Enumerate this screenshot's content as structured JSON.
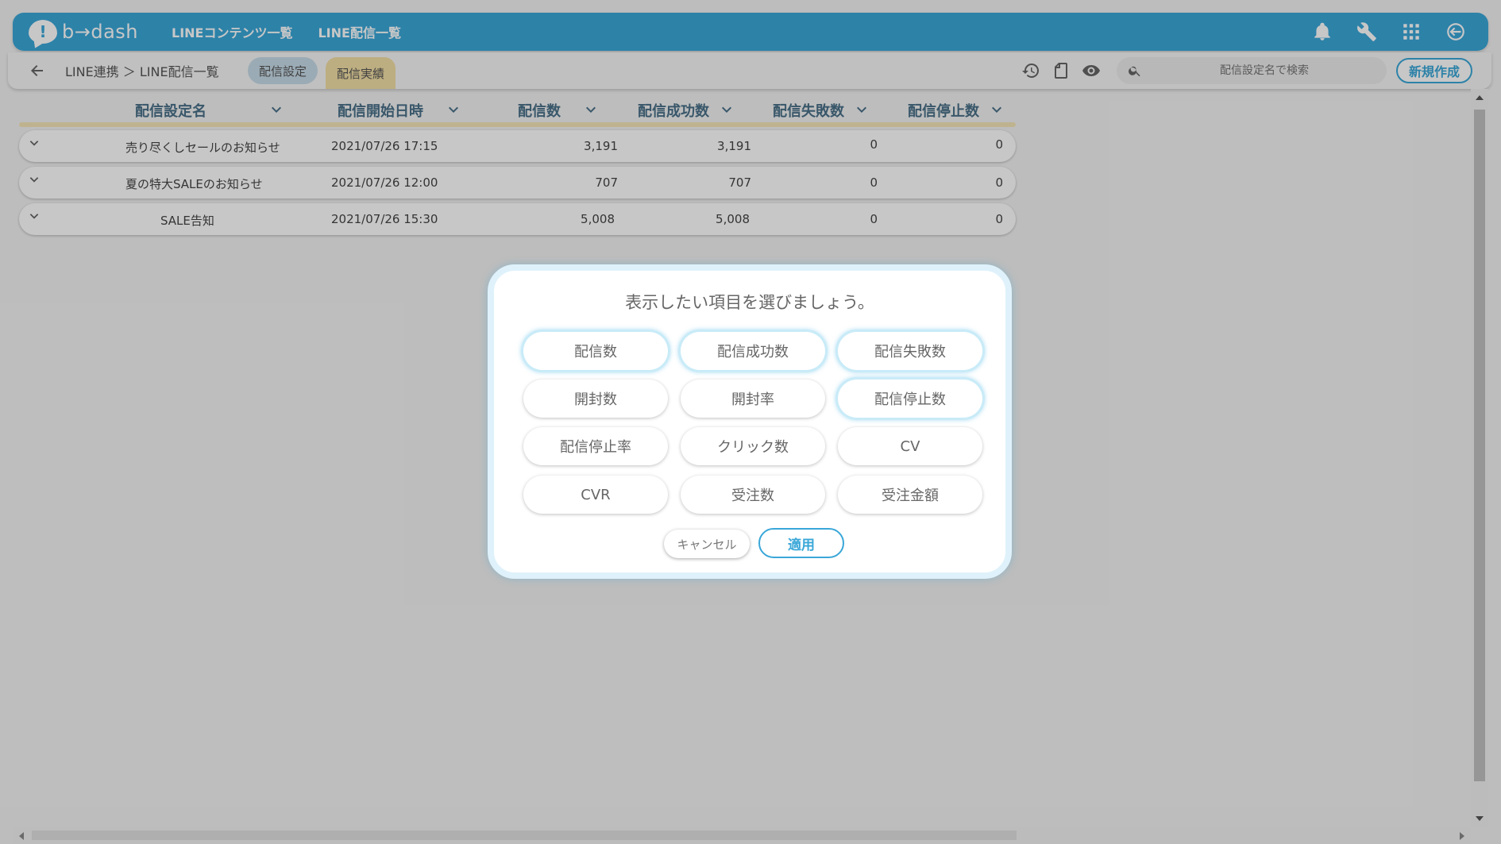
{
  "header": {
    "logo_text": "b→dash",
    "nav": [
      "LINEコンテンツ一覧",
      "LINE配信一覧"
    ],
    "icons": [
      "bell-icon",
      "wrench-icon",
      "grid-icon",
      "logout-icon"
    ]
  },
  "subbar": {
    "breadcrumb": "LINE連携 ＞ LINE配信一覧",
    "tab_settings": "配信設定",
    "tab_results": "配信実績",
    "search_placeholder": "配信設定名で検索",
    "new_button": "新規作成"
  },
  "table": {
    "columns": [
      "配信設定名",
      "配信開始日時",
      "配信数",
      "配信成功数",
      "配信失敗数",
      "配信停止数"
    ],
    "rows": [
      {
        "name": "売り尽くしセールのお知らせ",
        "start": "2021/07/26 17:15",
        "sent": "3,191",
        "success": "3,191",
        "failed": "0",
        "stopped": "0"
      },
      {
        "name": "夏の特大SALEのお知らせ",
        "start": "2021/07/26 12:00",
        "sent": "707",
        "success": "707",
        "failed": "0",
        "stopped": "0"
      },
      {
        "name": "SALE告知",
        "start": "2021/07/26 15:30",
        "sent": "5,008",
        "success": "5,008",
        "failed": "0",
        "stopped": "0"
      }
    ]
  },
  "modal": {
    "title": "表示したい項目を選びましょう。",
    "options": [
      {
        "label": "配信数",
        "selected": true
      },
      {
        "label": "配信成功数",
        "selected": true
      },
      {
        "label": "配信失敗数",
        "selected": true
      },
      {
        "label": "開封数",
        "selected": false
      },
      {
        "label": "開封率",
        "selected": false
      },
      {
        "label": "配信停止数",
        "selected": true
      },
      {
        "label": "配信停止率",
        "selected": false
      },
      {
        "label": "クリック数",
        "selected": false
      },
      {
        "label": "CV",
        "selected": false
      },
      {
        "label": "CVR",
        "selected": false
      },
      {
        "label": "受注数",
        "selected": false
      },
      {
        "label": "受注金額",
        "selected": false
      }
    ],
    "cancel": "キャンセル",
    "apply": "適用"
  },
  "colors": {
    "brand": "#3aa7d8",
    "header_text": "#4a7088",
    "results_tab": "#f2dfa6",
    "settings_tab": "#c7dce8"
  }
}
